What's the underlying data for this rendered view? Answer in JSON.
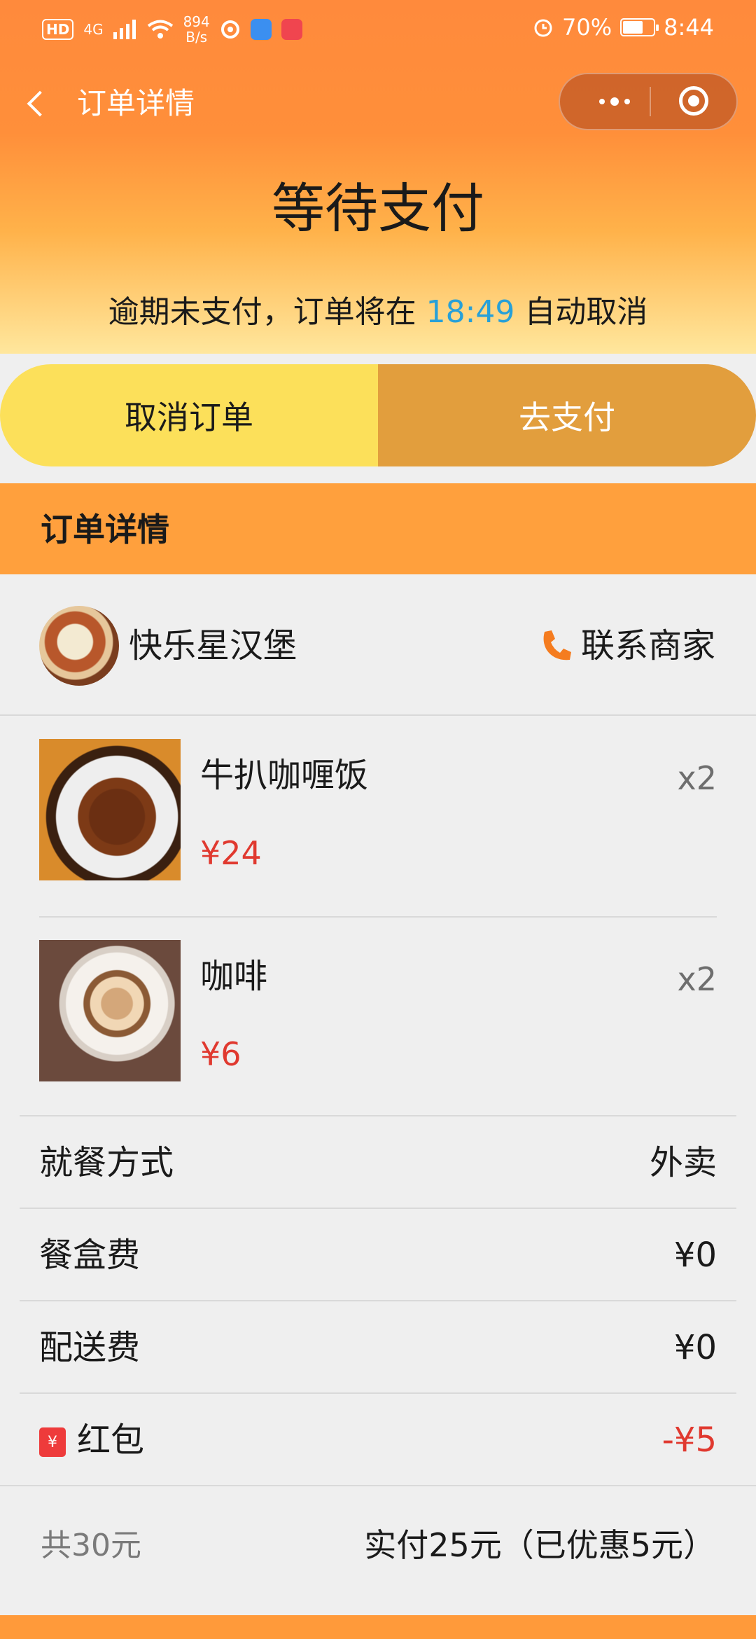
{
  "status_bar": {
    "hd": "HD",
    "network": "4G",
    "speed_value": "894",
    "speed_unit": "B/s",
    "battery": "70%",
    "battery_level": 0.7,
    "time": "8:44"
  },
  "nav": {
    "title": "订单详情"
  },
  "header": {
    "title": "等待支付",
    "notice_prefix": "逾期未支付，订单将在 ",
    "notice_time": "18:49",
    "notice_suffix": " 自动取消"
  },
  "actions": {
    "cancel_label": "取消订单",
    "pay_label": "去支付"
  },
  "section": {
    "title": "订单详情"
  },
  "shop": {
    "name": "快乐星汉堡",
    "contact_label": "联系商家"
  },
  "items": [
    {
      "name": "牛扒咖喱饭",
      "price": "¥24",
      "qty": "x2"
    },
    {
      "name": "咖啡",
      "price": "¥6",
      "qty": "x2"
    }
  ],
  "fees": {
    "dining_label": "就餐方式",
    "dining_value": "外卖",
    "box_label": "餐盒费",
    "box_value": "¥0",
    "delivery_label": "配送费",
    "delivery_value": "¥0",
    "coupon_icon": "¥",
    "coupon_label": "红包",
    "coupon_value": "-¥5"
  },
  "summary": {
    "total": "共30元",
    "paid": "实付25元（已优惠5元）"
  },
  "colors": {
    "accent": "#ff9a3a",
    "price": "#e0392f",
    "countdown": "#27a0d8"
  }
}
